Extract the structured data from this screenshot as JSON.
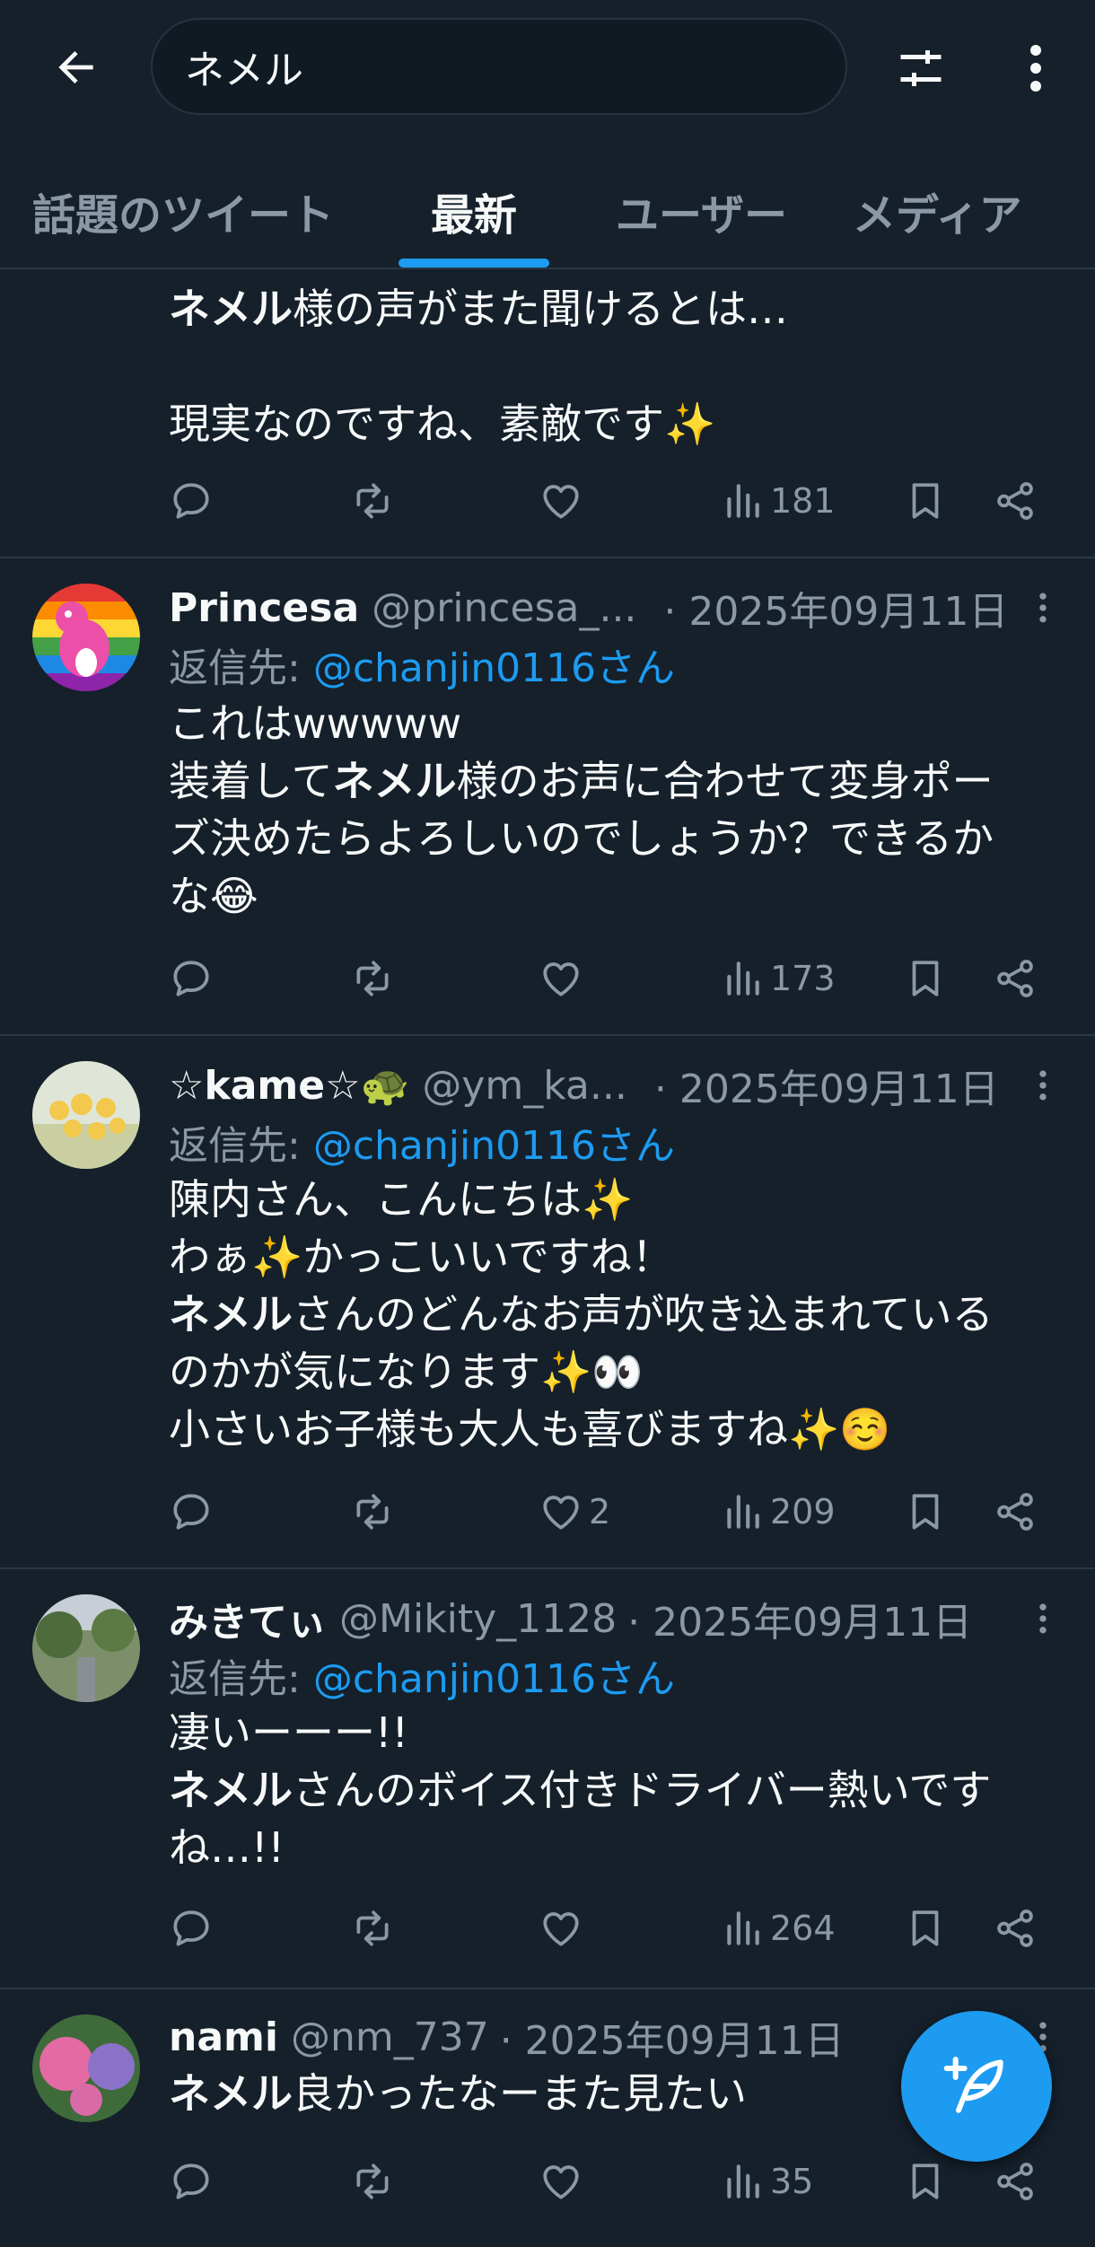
{
  "search": {
    "value": "ネメル"
  },
  "tabs": [
    {
      "label": "話題のツイート",
      "active": false
    },
    {
      "label": "最新",
      "active": true
    },
    {
      "label": "ユーザー",
      "active": false
    },
    {
      "label": "メディア",
      "active": false
    }
  ],
  "tweets": [
    {
      "partial": true,
      "text_lines": [
        {
          "bold": "ネメル",
          "rest": "様の声がまた聞けるとは…"
        },
        {
          "bold": "",
          "rest": ""
        },
        {
          "bold": "",
          "rest": "現実なのですね、素敵です✨"
        }
      ],
      "likes": "",
      "views": "181"
    },
    {
      "name": "Princesa",
      "handle": "@princesa_...",
      "date": "· 2025年09月11日",
      "reply_prefix": "返信先: ",
      "reply_to": "@chanjin0116さん",
      "text_lines": [
        {
          "bold": "",
          "rest": "これはwwwww"
        },
        {
          "pre": "装着して",
          "bold": "ネメル",
          "rest": "様のお声に合わせて変身ポー"
        },
        {
          "bold": "",
          "rest": "ズ決めたらよろしいのでしょうか？できるか"
        },
        {
          "bold": "",
          "rest": "な😂"
        }
      ],
      "likes": "",
      "views": "173"
    },
    {
      "name": "☆kame☆🐢",
      "handle": "@ym_ka...",
      "date": "· 2025年09月11日",
      "reply_prefix": "返信先: ",
      "reply_to": "@chanjin0116さん",
      "text_lines": [
        {
          "bold": "",
          "rest": "陳内さん、こんにちは✨"
        },
        {
          "bold": "",
          "rest": "わぁ✨かっこいいですね！"
        },
        {
          "bold": "ネメル",
          "rest": "さんのどんなお声が吹き込まれている"
        },
        {
          "bold": "",
          "rest": "のかが気になります✨👀"
        },
        {
          "bold": "",
          "rest": "小さいお子様も大人も喜びますね✨☺️"
        }
      ],
      "likes": "2",
      "views": "209"
    },
    {
      "name": "みきてぃ",
      "handle": "@Mikity_1128",
      "date": "· 2025年09月11日",
      "reply_prefix": "返信先: ",
      "reply_to": "@chanjin0116さん",
      "text_lines": [
        {
          "bold": "",
          "rest": "凄いーーー!!"
        },
        {
          "bold": "ネメル",
          "rest": "さんのボイス付きドライバー熱いです"
        },
        {
          "bold": "",
          "rest": "ね…!!"
        }
      ],
      "likes": "",
      "views": "264"
    },
    {
      "name": "nami",
      "handle": "@nm_737",
      "date": "· 2025年09月11日",
      "text_lines": [
        {
          "bold": "ネメル",
          "rest": "良かったなーまた見たい"
        }
      ],
      "likes": "",
      "views": "35"
    }
  ],
  "icons": {
    "back": "arrow-left-icon",
    "filter": "sliders-icon",
    "more": "more-vertical-icon",
    "reply": "reply-icon",
    "retweet": "retweet-icon",
    "like": "heart-icon",
    "views": "views-icon",
    "bookmark": "bookmark-icon",
    "share": "share-icon",
    "compose": "compose-feather-icon"
  },
  "colors": {
    "background": "#15202b",
    "accent": "#1d9bf0",
    "muted": "#8b98a5",
    "divider": "#2a3744"
  }
}
